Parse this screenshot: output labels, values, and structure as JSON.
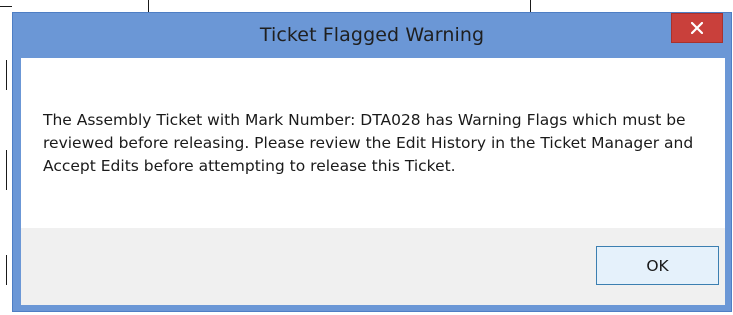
{
  "dialog": {
    "title": "Ticket Flagged Warning",
    "close_icon": "close-icon",
    "message": "The Assembly Ticket with Mark Number: DTA028 has Warning Flags which must be reviewed before releasing. Please review the Edit History in the Ticket Manager and Accept Edits before attempting to release this Ticket.",
    "ok_label": "OK"
  },
  "colors": {
    "frame": "#6b97d6",
    "close_button": "#c9403b",
    "footer": "#f0f0f0",
    "ok_button": "#e5f1fb",
    "ok_border": "#3c7fb1"
  }
}
